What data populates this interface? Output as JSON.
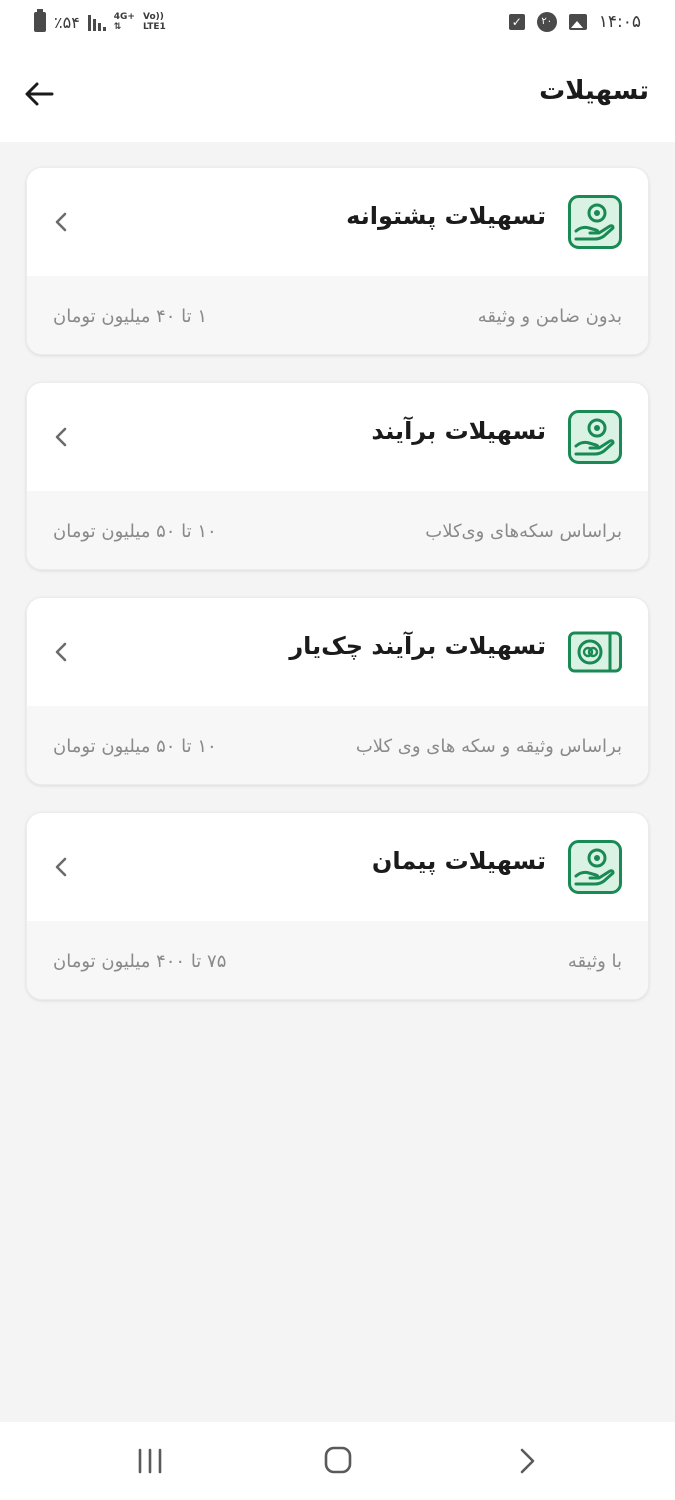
{
  "status_bar": {
    "battery": "٪۵۴",
    "net_top": "4G+",
    "net_bottom": "LTE1",
    "volte": "Vo))",
    "notif_count": "۲۰",
    "time": "۱۴:۰۵"
  },
  "header": {
    "title": "تسهیلات",
    "back_icon": "arrow-left-icon"
  },
  "cards": [
    {
      "title": "تسهیلات پشتوانه",
      "subtitle": "بدون ضامن و وثیقه",
      "range": "۱ تا ۴۰ میلیون تومان",
      "icon": "hand-coin-icon"
    },
    {
      "title": "تسهیلات برآیند",
      "subtitle": "براساس سکه‌های وی‌کلاب",
      "range": "۱۰ تا ۵۰ میلیون تومان",
      "icon": "hand-coin-icon"
    },
    {
      "title": "تسهیلات برآیند چک‌یار",
      "subtitle": "براساس وثیقه و سکه های وی کلاب",
      "range": "۱۰ تا ۵۰ میلیون تومان",
      "icon": "cheque-icon"
    },
    {
      "title": "تسهیلات پیمان",
      "subtitle": "با وثیقه",
      "range": "۷۵ تا ۴۰۰ میلیون تومان",
      "icon": "hand-coin-icon"
    }
  ],
  "colors": {
    "accent_green": "#1a8a55",
    "icon_bg": "#d9f2e4",
    "page_bg": "#f4f4f5"
  },
  "nav": {
    "recent_icon": "recent-apps-icon",
    "home_icon": "home-icon",
    "back_icon": "back-icon"
  }
}
